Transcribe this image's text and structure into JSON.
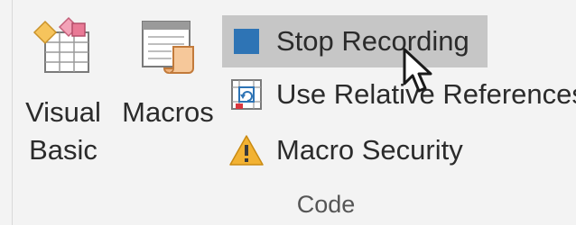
{
  "group": {
    "label": "Code"
  },
  "buttons": {
    "visual_basic": {
      "line1": "Visual",
      "line2": "Basic",
      "icon": "visual-basic-icon"
    },
    "macros": {
      "label": "Macros",
      "icon": "macros-icon"
    },
    "stop_recording": {
      "label": "Stop Recording",
      "icon": "stop-square-icon",
      "state": "hovered"
    },
    "relative_refs": {
      "label": "Use Relative References",
      "icon": "relative-references-icon"
    },
    "macro_security": {
      "label": "Macro Security",
      "icon": "warning-icon"
    }
  },
  "colors": {
    "ribbon_bg": "#f3f3f3",
    "hover_bg": "#c6c6c6",
    "stop_blue": "#2e74b5",
    "warning_yellow": "#f2b233",
    "text": "#2b2b2b"
  }
}
